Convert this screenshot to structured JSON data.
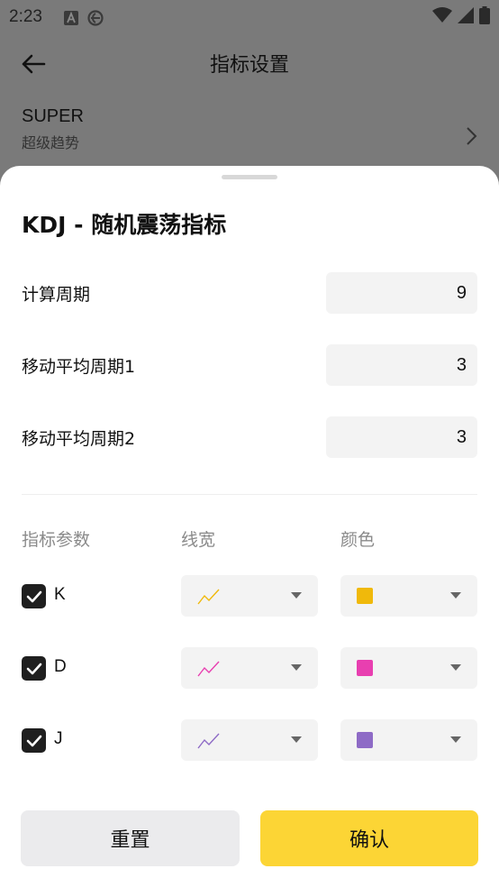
{
  "status_bar": {
    "time": "2:23"
  },
  "header": {
    "title": "指标设置"
  },
  "background_item": {
    "title": "SUPER",
    "subtitle": "超级趋势"
  },
  "sheet": {
    "title": "KDJ - 随机震荡指标",
    "params": [
      {
        "label": "计算周期",
        "value": "9"
      },
      {
        "label": "移动平均周期1",
        "value": "3"
      },
      {
        "label": "移动平均周期2",
        "value": "3"
      }
    ],
    "columns": {
      "param": "指标参数",
      "width": "线宽",
      "color": "颜色"
    },
    "lines": [
      {
        "name": "K",
        "checked": true,
        "color": "#f0b90b"
      },
      {
        "name": "D",
        "checked": true,
        "color": "#e83fb0"
      },
      {
        "name": "J",
        "checked": true,
        "color": "#8e6bc6"
      }
    ],
    "buttons": {
      "reset": "重置",
      "confirm": "确认"
    }
  }
}
